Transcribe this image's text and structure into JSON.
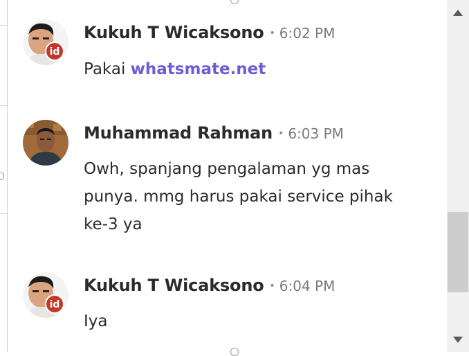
{
  "messages": [
    {
      "sender": "Kukuh T Wicaksono",
      "separator": "•",
      "time": "6:02 PM",
      "text_prefix": "Pakai ",
      "link_text": "whatsmate.net",
      "avatar_badge": "id"
    },
    {
      "sender": "Muhammad Rahman",
      "separator": "•",
      "time": "6:03 PM",
      "text": "Owh, spanjang pengalaman yg mas punya. mmg harus pakai service pihak ke-3 ya"
    },
    {
      "sender": "Kukuh T Wicaksono",
      "separator": "•",
      "time": "6:04 PM",
      "text": "Iya",
      "avatar_badge": "id"
    }
  ],
  "colors": {
    "link": "#6b5ed6",
    "text": "#2b2b2b",
    "time": "#7a7a7a",
    "badge": "#c0392b",
    "scroll_thumb": "#cdcdcd"
  },
  "icons": {
    "scroll_up": "triangle-up-icon",
    "scroll_down": "triangle-down-icon"
  }
}
